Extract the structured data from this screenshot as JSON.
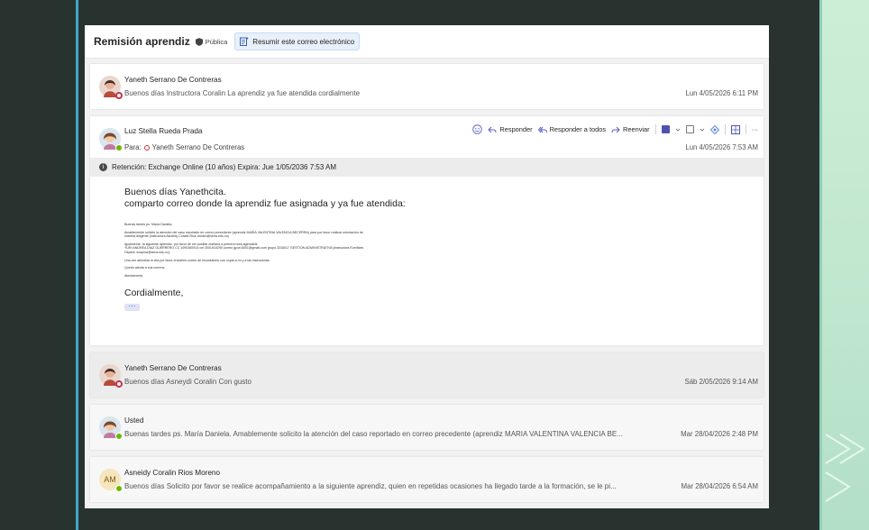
{
  "subject": {
    "title": "Remisión aprendiz",
    "visibility": "Pública",
    "summarize_label": "Resumir este correo electrónico"
  },
  "messages": [
    {
      "sender": "Yaneth Serrano De Contreras",
      "preview": "Buenos días Instructora Coralin La aprendiz ya fue atendida cordialmente",
      "date": "Lun 4/05/2026 6:11 PM"
    },
    {
      "sender": "Luz Stella Rueda Prada",
      "to_label": "Para:",
      "to_name": "Yaneth Serrano De Contreras",
      "date": "Lun 4/05/2026 7:53 AM",
      "retention": "Retención: Exchange Online (10 años) Expira: Jue 1/05/2036 7:53 AM",
      "greeting": "Buenos días Yanethcita.",
      "intro": "comparto correo donde la aprendiz fue asignada y ya fue atendida:",
      "quoted": [
        "Buenas tardes ps. María Daniela.",
        "Amablemente solicito la atención del caso reportado en correo precedente (aprendiz MARIA VALENTINA VALENCIA BECERRA) para por favor realizar orientación de",
        "manera diligente (instructora Asneidy Coralin Rios ariosm@sena.edu.co)",
        "Igualmente, la siguiente aprendiz, por favor de ser posible mañana a primera hora agendarle",
        "YURI ANDREA DIAZ GUERRERO CC 1090360914 cel 3001910290 correo gyuri.6001@gmail.com grupo 3316017 GESTION ADMINISTRATIVA (instructora Everildes",
        "Ospina: eospina@sena.edu.co)",
        "Una vez atendida la cita por favor enviarles correo de recordatorio con copia a mí y a las instructoras.",
        "Quedo atenta a sus correos.",
        "Atentamente,"
      ],
      "closing": "Cordialmente,",
      "more": "···"
    },
    {
      "sender": "Yaneth Serrano De Contreras",
      "preview": "Buenos días Asneydi Coralin Con gusto",
      "date": "Sáb 2/05/2026 9:14 AM"
    },
    {
      "sender": "Usted",
      "preview": "Buenas tardes ps. María Daniela. Amablemente solicito la atención del caso reportado en correo precedente (aprendiz MARIA VALENTINA VALENCIA BE...",
      "date": "Mar 28/04/2026 2:48 PM"
    },
    {
      "sender": "Asneidy Coralin Rios Moreno",
      "initials": "AM",
      "preview": "Buenos días Solicito por favor se realice acompañamiento a la siguiente aprendiz, quien en repetidas ocasiones ha llegado tarde a la formación, se le pi...",
      "date": "Mar 28/04/2026 6:54 AM"
    }
  ],
  "actions": {
    "reply": "Responder",
    "reply_all": "Responder a todos",
    "forward": "Reenviar",
    "more": "···"
  },
  "colors": {
    "accent": "#5b5fc7",
    "presence_away": "#c4314b",
    "presence_available": "#6bb700",
    "frame_line": "#41a7c8"
  },
  "icons": [
    "shield-icon",
    "summarize-icon",
    "emoji-icon",
    "reply-icon",
    "reply-all-icon",
    "forward-icon",
    "teams-icon",
    "chevron-down-icon",
    "note-icon",
    "loop-icon",
    "apps-icon",
    "more-icon",
    "info-icon"
  ]
}
